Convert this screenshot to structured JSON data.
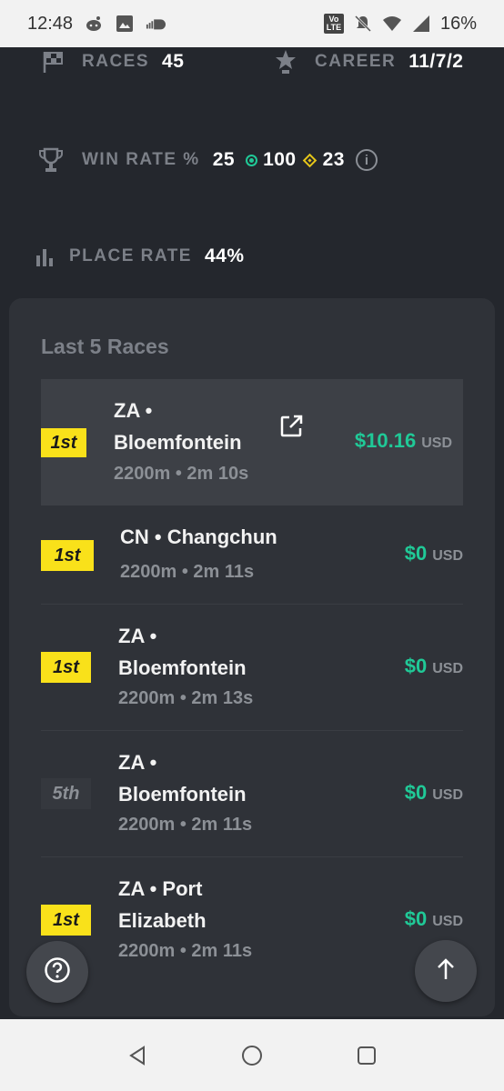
{
  "status_bar": {
    "time": "12:48",
    "battery": "16%",
    "volte": "Vo LTE",
    "icons": [
      "reddit-icon",
      "image-icon",
      "soundcloud-icon",
      "volte-icon",
      "bell-off-icon",
      "wifi-icon",
      "signal-icon"
    ]
  },
  "stats": {
    "races_label": "RACES",
    "races_value": "45",
    "career_label": "CAREER",
    "career_value": "11/7/2",
    "win_rate_label": "WIN RATE %",
    "win_rate_value": "25",
    "win_rate_green": "100",
    "win_rate_yellow": "23",
    "place_rate_label": "PLACE RATE",
    "place_rate_value": "44%"
  },
  "last_races": {
    "title": "Last 5 Races",
    "rows": [
      {
        "position": "1st",
        "location": [
          "ZA •",
          "Bloemfontein"
        ],
        "meta": "2200m • 2m 10s",
        "prize": "$10.16",
        "currency": "USD"
      },
      {
        "position": "1st",
        "location": [
          "CN • Changchun"
        ],
        "meta": "2200m • 2m 11s",
        "prize": "$0",
        "currency": "USD"
      },
      {
        "position": "1st",
        "location": [
          "ZA •",
          "Bloemfontein"
        ],
        "meta": "2200m • 2m 13s",
        "prize": "$0",
        "currency": "USD"
      },
      {
        "position": "5th",
        "location": [
          "ZA •",
          "Bloemfontein"
        ],
        "meta": "2200m • 2m 11s",
        "prize": "$0",
        "currency": "USD"
      },
      {
        "position": "1st",
        "location": [
          "ZA • Port",
          "Elizabeth"
        ],
        "meta": "2200m • 2m 11s",
        "prize": "$0",
        "currency": "USD"
      }
    ]
  },
  "colors": {
    "background": "#24272d",
    "card": "#2f3238",
    "accent_green": "#20c997",
    "badge_yellow": "#f9e11a",
    "muted": "#7c8088"
  }
}
